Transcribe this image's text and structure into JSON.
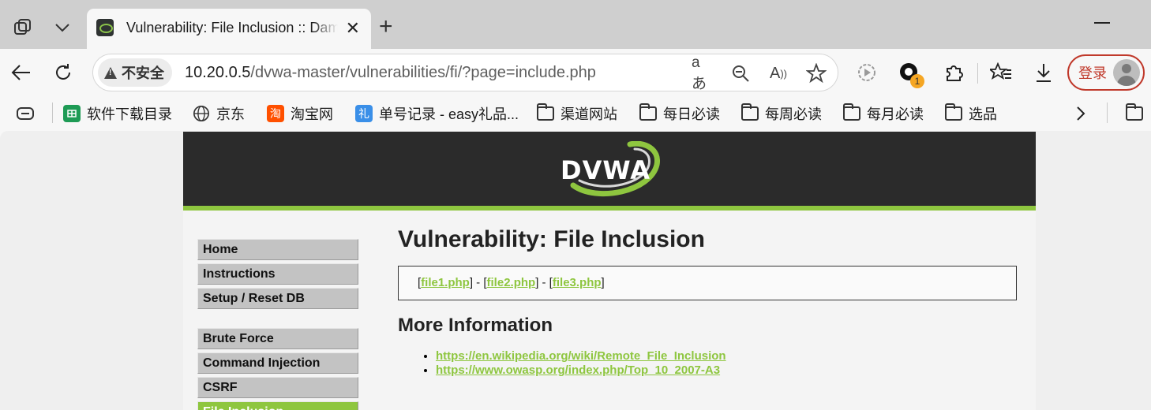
{
  "browser": {
    "tab": {
      "title": "Vulnerability: File Inclusion :: Damn Vulnerable Web Application (DVWA)"
    },
    "address_bar": {
      "security_label": "不安全",
      "url_host": "10.20.0.5",
      "url_path": "/dvwa-master/vulnerabilities/fi/?page=include.php"
    },
    "extension_badge": "1",
    "login_label": "登录",
    "bookmarks": [
      {
        "label": "软件下载目录",
        "icon": "sheets-icon",
        "color": "#1e9b55"
      },
      {
        "label": "京东",
        "icon": "globe-icon"
      },
      {
        "label": "淘宝网",
        "icon": "taobao-icon",
        "color": "#ff5000",
        "glyph": "淘"
      },
      {
        "label": "单号记录 - easy礼品...",
        "icon": "gift-icon",
        "color": "#3a8fe8",
        "glyph": "礼"
      },
      {
        "label": "渠道网站",
        "icon": "folder-icon"
      },
      {
        "label": "每日必读",
        "icon": "folder-icon"
      },
      {
        "label": "每周必读",
        "icon": "folder-icon"
      },
      {
        "label": "每月必读",
        "icon": "folder-icon"
      },
      {
        "label": "选品",
        "icon": "folder-icon"
      }
    ]
  },
  "dvwa": {
    "logo_text": "DVWA",
    "accent_color": "#8ec63f",
    "menu": [
      "Home",
      "Instructions",
      "Setup / Reset DB",
      "Brute Force",
      "Command Injection",
      "CSRF",
      "File Inclusion"
    ],
    "active_menu": "File Inclusion",
    "page_title": "Vulnerability: File Inclusion",
    "files": [
      "file1.php",
      "file2.php",
      "file3.php"
    ],
    "more_info_title": "More Information",
    "more_info_links": [
      "https://en.wikipedia.org/wiki/Remote_File_Inclusion",
      "https://www.owasp.org/index.php/Top_10_2007-A3"
    ]
  }
}
